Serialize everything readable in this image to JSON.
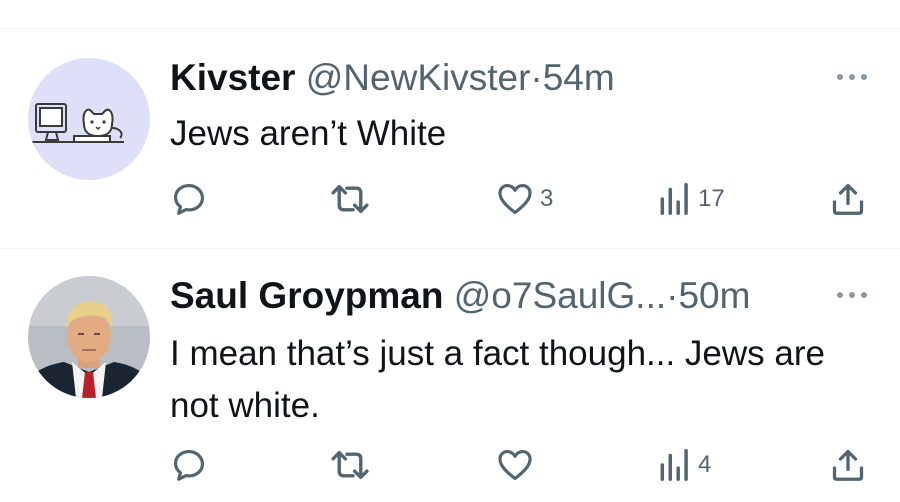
{
  "tweets": [
    {
      "display_name": "Kivster",
      "handle": "@NewKivster",
      "separator": "·",
      "time": "54m",
      "text": "Jews aren’t White",
      "avatar_icon": "cat-at-computer-avatar",
      "actions": {
        "reply_count": "",
        "retweet_count": "",
        "like_count": "3",
        "views_count": "17"
      }
    },
    {
      "display_name": "Saul Groypman",
      "handle": "@o7SaulG...",
      "separator": "·",
      "time": "50m",
      "text": "I mean that’s just a fact though... Jews are not white.",
      "avatar_icon": "portrait-photo-avatar",
      "actions": {
        "reply_count": "",
        "retweet_count": "",
        "like_count": "",
        "views_count": "4"
      }
    }
  ],
  "colors": {
    "text": "#0f1419",
    "secondary": "#536471",
    "divider": "#eff3f4",
    "avatar_bg": "#dde0f6"
  }
}
